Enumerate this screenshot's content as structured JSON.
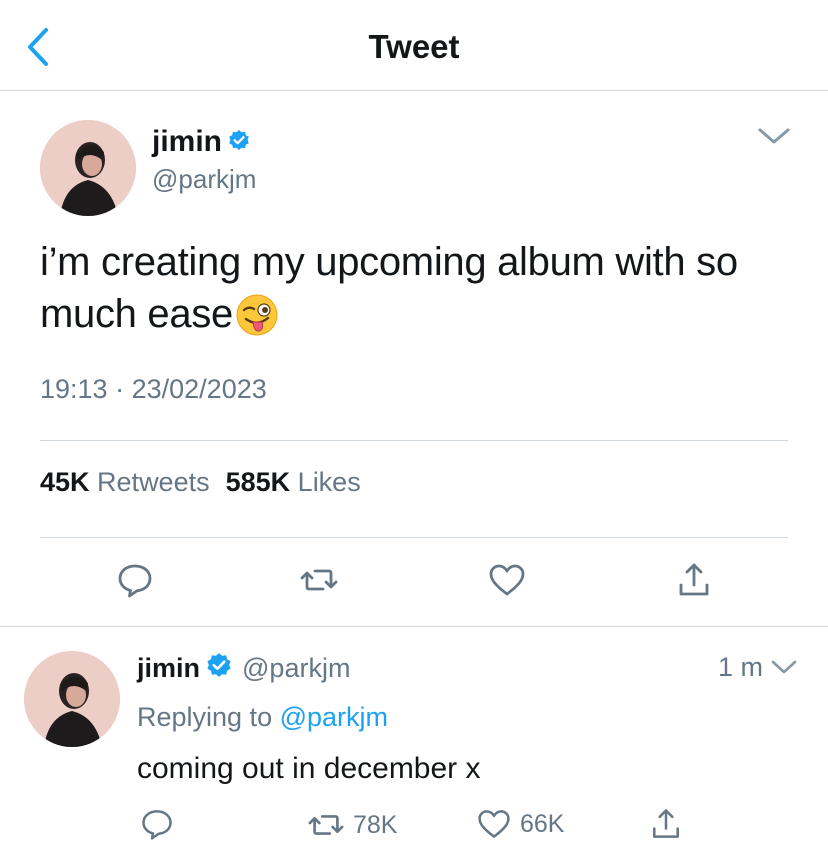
{
  "header": {
    "title": "Tweet"
  },
  "tweet": {
    "author_name": "jimin",
    "author_handle": "@parkjm",
    "text": "i’m creating my upcoming album with so much ease",
    "emoji": "winking-face-with-tongue",
    "time": "19:13",
    "separator": "·",
    "date": "23/02/2023",
    "retweet_count": "45K",
    "retweet_label": "Retweets",
    "like_count": "585K",
    "like_label": "Likes"
  },
  "reply": {
    "author_name": "jimin",
    "author_handle": "@parkjm",
    "time_ago": "1 m",
    "replying_prefix": "Replying to",
    "replying_to": "@parkjm",
    "text": "coming out in december x",
    "retweet_count": "78K",
    "like_count": "66K"
  },
  "colors": {
    "accent": "#1da1f2",
    "secondary_text": "#657786",
    "primary_text": "#14171a",
    "divider": "#cfd6dc"
  },
  "icons": [
    "chevron-left-icon",
    "verified-badge-icon",
    "chevron-down-icon",
    "reply-icon",
    "retweet-icon",
    "like-icon",
    "share-icon"
  ]
}
